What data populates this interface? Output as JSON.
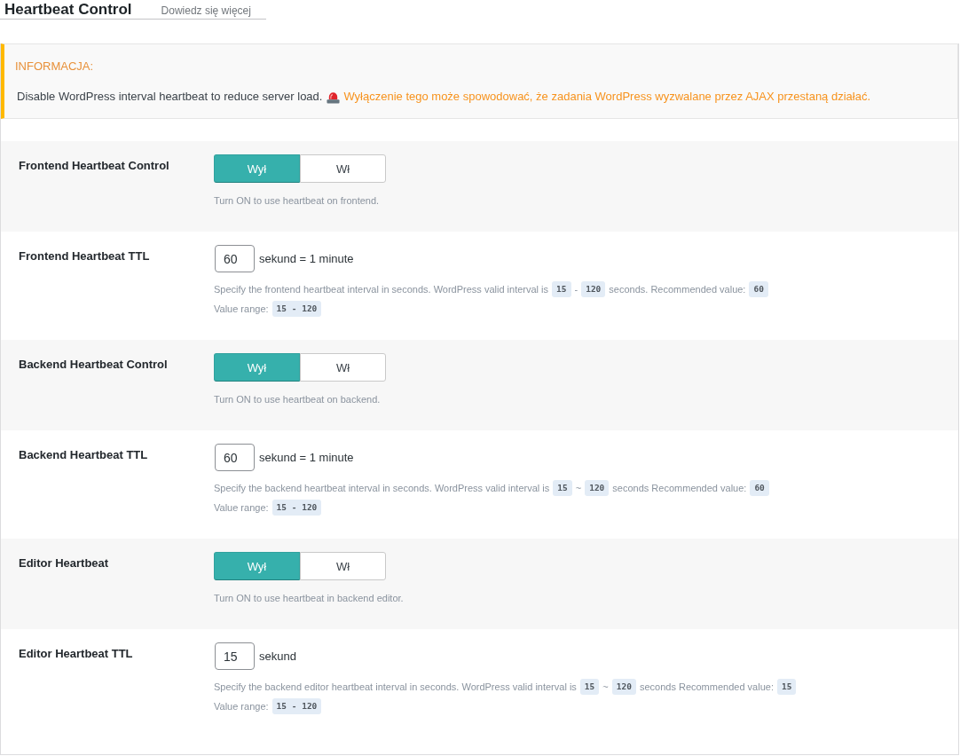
{
  "header": {
    "title": "Heartbeat Control",
    "link": "Dowiedz się więcej"
  },
  "notice": {
    "label": "INFORMACJA:",
    "text": "Disable WordPress interval heartbeat to reduce server load.",
    "warning": "Wyłączenie tego może spowodować, że zadania WordPress wyzwalane przez AJAX przestaną działać."
  },
  "settings": [
    {
      "kind": "toggle",
      "label": "Frontend Heartbeat Control",
      "options": [
        {
          "label": "Wył",
          "selected": true
        },
        {
          "label": "Wł",
          "selected": false
        }
      ],
      "description": [
        {
          "kind": "text",
          "text": "Turn ON to use heartbeat on frontend."
        }
      ]
    },
    {
      "kind": "number",
      "label": "Frontend Heartbeat TTL",
      "value": "60",
      "unit": "sekund = 1 minute",
      "description": [
        {
          "kind": "text",
          "text": "Specify the frontend heartbeat interval in seconds. WordPress valid interval is"
        },
        {
          "kind": "code",
          "text": "15"
        },
        {
          "kind": "text",
          "text": "-"
        },
        {
          "kind": "code",
          "text": "120"
        },
        {
          "kind": "text",
          "text": "seconds. Recommended value:"
        },
        {
          "kind": "code",
          "text": "60"
        }
      ],
      "range": {
        "label": "Value range:",
        "value": "15 - 120"
      }
    },
    {
      "kind": "toggle",
      "label": "Backend Heartbeat Control",
      "options": [
        {
          "label": "Wył",
          "selected": true
        },
        {
          "label": "Wł",
          "selected": false
        }
      ],
      "description": [
        {
          "kind": "text",
          "text": "Turn ON to use heartbeat on backend."
        }
      ]
    },
    {
      "kind": "number",
      "label": "Backend Heartbeat TTL",
      "value": "60",
      "unit": "sekund = 1 minute",
      "description": [
        {
          "kind": "text",
          "text": "Specify the backend heartbeat interval in seconds. WordPress valid interval is"
        },
        {
          "kind": "code",
          "text": "15"
        },
        {
          "kind": "text",
          "text": "~"
        },
        {
          "kind": "code",
          "text": "120"
        },
        {
          "kind": "text",
          "text": "seconds Recommended value:"
        },
        {
          "kind": "code",
          "text": "60"
        }
      ],
      "range": {
        "label": "Value range:",
        "value": "15 - 120"
      }
    },
    {
      "kind": "toggle",
      "label": "Editor Heartbeat",
      "options": [
        {
          "label": "Wył",
          "selected": true
        },
        {
          "label": "Wł",
          "selected": false
        }
      ],
      "description": [
        {
          "kind": "text",
          "text": "Turn ON to use heartbeat in backend editor."
        }
      ]
    },
    {
      "kind": "number",
      "label": "Editor Heartbeat TTL",
      "value": "15",
      "unit": "sekund",
      "description": [
        {
          "kind": "text",
          "text": "Specify the backend editor heartbeat interval in seconds. WordPress valid interval is"
        },
        {
          "kind": "code",
          "text": "15"
        },
        {
          "kind": "text",
          "text": "~"
        },
        {
          "kind": "code",
          "text": "120"
        },
        {
          "kind": "text",
          "text": "seconds Recommended value:"
        },
        {
          "kind": "code",
          "text": "15"
        }
      ],
      "range": {
        "label": "Value range:",
        "value": "15 - 120"
      }
    }
  ]
}
